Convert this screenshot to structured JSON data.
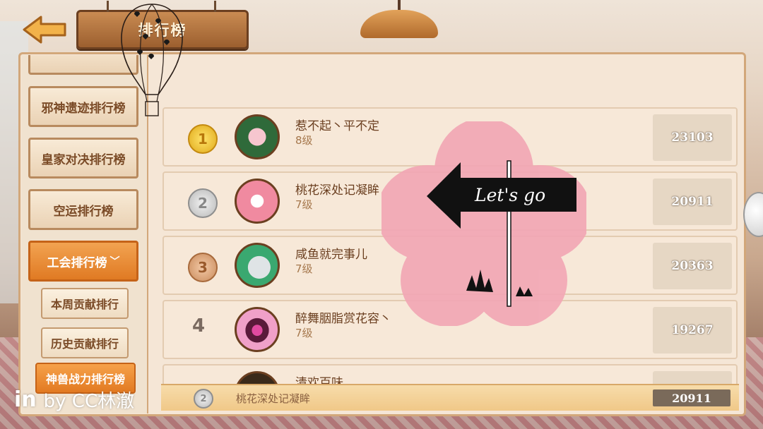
{
  "header": {
    "title": "排行榜",
    "back_icon": "back-arrow-icon"
  },
  "sidebar": {
    "partial_top_label": "",
    "items": [
      {
        "label": "邪神遗迹排行榜"
      },
      {
        "label": "皇家对决排行榜"
      },
      {
        "label": "空运排行榜"
      },
      {
        "label": "工会排行榜",
        "active": true,
        "expanded_icon": "chevron-down-icon"
      }
    ],
    "sub_items": [
      {
        "label": "本周贡献排行"
      },
      {
        "label": "历史贡献排行"
      },
      {
        "label": "神兽战力排行榜",
        "active": true
      }
    ]
  },
  "ranking": {
    "rows": [
      {
        "rank": "1",
        "medal": "gold",
        "name": "惹不起丶平不定",
        "level": "8级",
        "score": "23103",
        "avatar": "rose-avatar-icon"
      },
      {
        "rank": "2",
        "medal": "silver",
        "name": "桃花深处记凝眸",
        "level": "7级",
        "score": "20911",
        "avatar": "sakura-avatar-icon"
      },
      {
        "rank": "3",
        "medal": "bronze",
        "name": "咸鱼就完事儿",
        "level": "7级",
        "score": "20363",
        "avatar": "fish-avatar-icon"
      },
      {
        "rank": "4",
        "medal": "none",
        "name": "醉舞胭脂赏花容丶",
        "level": "7级",
        "score": "19267",
        "avatar": "eye-avatar-icon"
      },
      {
        "rank": "",
        "medal": "none",
        "name": "清欢百味",
        "level": "",
        "score": "",
        "avatar": "dark-avatar-icon"
      }
    ]
  },
  "my_rank": {
    "rank": "2",
    "name": "桃花深处记凝眸",
    "score": "20911"
  },
  "sticker": {
    "text": "Let's go"
  },
  "watermark": {
    "logo": "in",
    "text": "by CC林澈"
  },
  "colors": {
    "accent_orange": "#e07a23",
    "panel": "#f5e6d6",
    "wood": "#9c5f2f"
  }
}
